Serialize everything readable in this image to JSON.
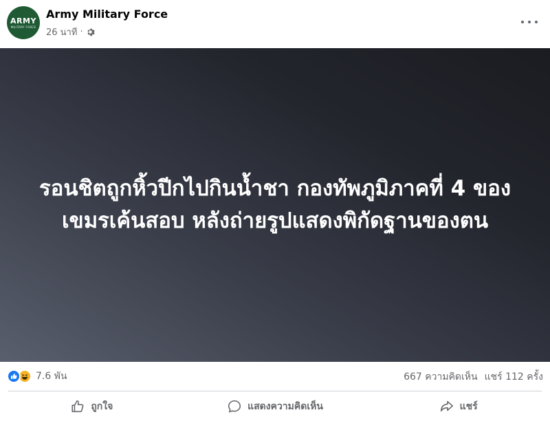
{
  "post": {
    "page_name": "Army Military Force",
    "time": "26 นาที",
    "separator": "·",
    "avatar_text": "ARMY",
    "avatar_subtext": "MILITARY FORCE",
    "headline": "รอนชิตถูกหิ้วปีกไปกินน้ำชา กองทัพภูมิภาคที่ 4 ของเขมรเค้นสอบ หลังถ่ายรูปแสดงพิกัดฐานของตน"
  },
  "stats": {
    "reaction_count": "7.6 พัน",
    "comments": "667 ความคิดเห็น",
    "shares": "แชร์ 112 ครั้ง"
  },
  "actions": {
    "like": "ถูกใจ",
    "comment": "แสดงความคิดเห็น",
    "share": "แชร์"
  },
  "icons": [
    "gear-icon",
    "more-icon",
    "like-reaction-icon",
    "haha-reaction-icon",
    "thumbs-up-icon",
    "comment-icon",
    "share-icon"
  ],
  "colors": {
    "brand": "#1877f2",
    "muted": "#65676b",
    "avatar_bg": "#1f5a34"
  }
}
